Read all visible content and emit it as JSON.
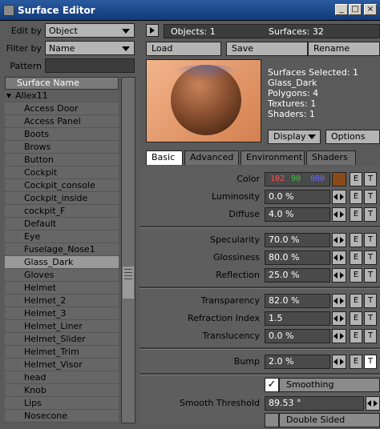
{
  "window": {
    "title": "Surface Editor",
    "min_glyph": "_",
    "max_glyph": "□",
    "close_glyph": "×"
  },
  "left": {
    "edit_by": {
      "label": "Edit by",
      "value": "Object"
    },
    "filter_by": {
      "label": "Filter by",
      "value": "Name"
    },
    "pattern": {
      "label": "Pattern",
      "value": ""
    },
    "list_header": "Surface Name",
    "group": "Allex11",
    "items": [
      "Access Door",
      "Access Panel",
      "Boots",
      "Brows",
      "Button",
      "Cockpit",
      "Cockpit_console",
      "Cockpit_inside",
      "cockpit_F",
      "Default",
      "Eye",
      "Fuselage_Nose1",
      "Glass_Dark",
      "Gloves",
      "Helmet",
      "Helmet_2",
      "Helmet_3",
      "Helmet_Liner",
      "Helmet_Slider",
      "Helmet_Trim",
      "Helmet_Visor",
      "head",
      "Knob",
      "Lips",
      "Nosecone"
    ],
    "selected_item": "Glass_Dark"
  },
  "right": {
    "objects": "Objects: 1",
    "surfaces": "Surfaces: 32",
    "load": "Load",
    "save": "Save",
    "rename": "Rename",
    "selection_info": [
      "Surfaces Selected: 1",
      "Glass_Dark",
      "Polygons: 4",
      "Textures: 1",
      "Shaders: 1"
    ],
    "display": "Display",
    "options": "Options",
    "tabs": [
      "Basic",
      "Advanced",
      "Environment",
      "Shaders"
    ],
    "active_tab": "Basic",
    "props": {
      "color": {
        "label": "Color",
        "r": "102",
        "g": "90",
        "b": "000",
        "swatch": "#8a4a1a"
      },
      "luminosity": {
        "label": "Luminosity",
        "value": "0.0 %"
      },
      "diffuse": {
        "label": "Diffuse",
        "value": "4.0 %"
      },
      "specularity": {
        "label": "Specularity",
        "value": "70.0 %"
      },
      "glossiness": {
        "label": "Glossiness",
        "value": "80.0 %"
      },
      "reflection": {
        "label": "Reflection",
        "value": "25.0 %"
      },
      "transparency": {
        "label": "Transparency",
        "value": "82.0 %"
      },
      "refraction": {
        "label": "Refraction Index",
        "value": "1.5"
      },
      "translucency": {
        "label": "Translucency",
        "value": "0.0 %"
      },
      "bump": {
        "label": "Bump",
        "value": "2.0 %"
      },
      "smoothing": {
        "label": "Smoothing",
        "checked": true
      },
      "smooth_threshold": {
        "label": "Smooth Threshold",
        "value": "89.53 °"
      },
      "double_sided": {
        "label": "Double Sided"
      }
    },
    "e_label": "E",
    "t_label": "T"
  },
  "colors": {
    "accent": "#123a78",
    "panel": "#5a5a5a",
    "field": "#4a4a4a",
    "button": "#b4b4b4"
  }
}
